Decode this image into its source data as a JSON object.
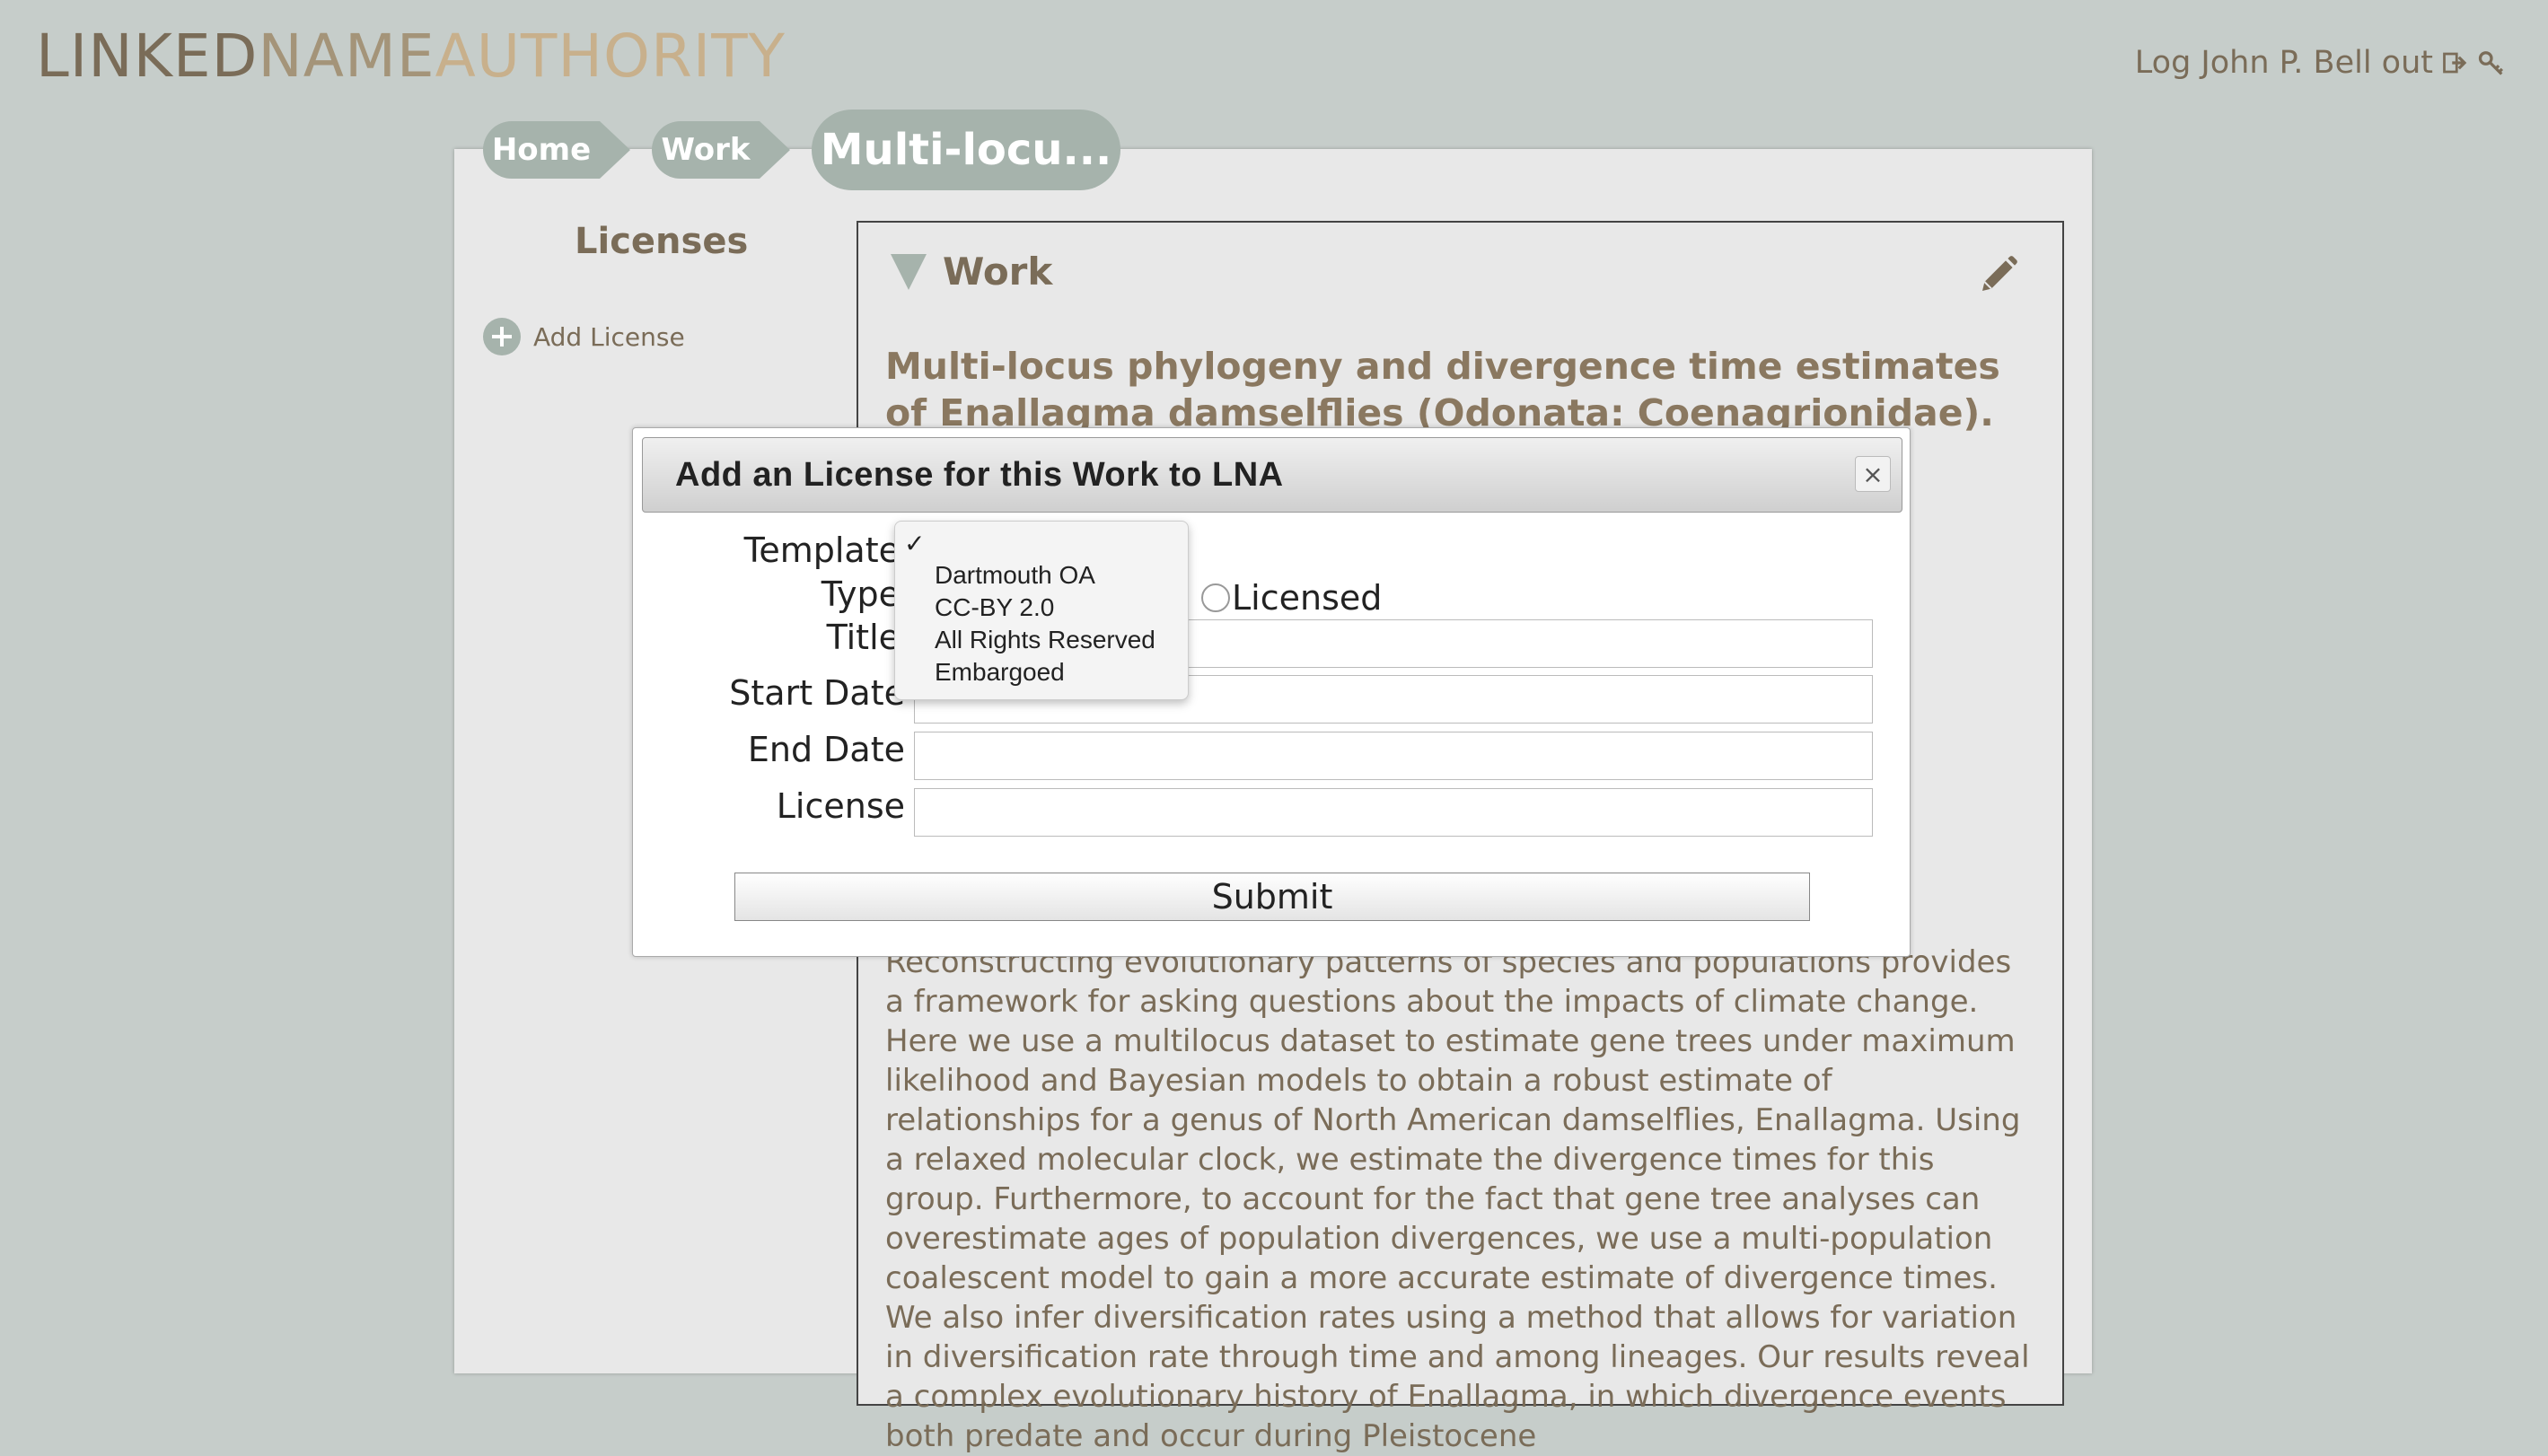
{
  "header": {
    "logo_part1": "LINKED",
    "logo_part2": "NAME",
    "logo_part3": "AUTHORITY",
    "logout_text": "Log John P. Bell out"
  },
  "breadcrumb": {
    "home": "Home",
    "work": "Work",
    "current": "Multi-locu..."
  },
  "sidebar": {
    "title": "Licenses",
    "add_license": "Add License"
  },
  "work": {
    "heading": "Work",
    "title": "Multi-locus phylogeny and divergence time estimates of Enallagma damselflies (Odonata: Coenagrionidae).",
    "abstract": "Reconstructing evolutionary patterns of species and populations provides a framework for asking questions about the impacts of climate change. Here we use a multilocus dataset to estimate gene trees under maximum likelihood and Bayesian models to obtain a robust estimate of relationships for a genus of North American damselflies, Enallagma. Using a relaxed molecular clock, we estimate the divergence times for this group. Furthermore, to account for the fact that gene tree analyses can overestimate ages of population divergences, we use a multi-population coalescent model to gain a more accurate estimate of divergence times. We also infer diversification rates using a method that allows for variation in diversification rate through time and among lineages. Our results reveal a complex evolutionary history of Enallagma, in which divergence events both predate and occur during Pleistocene"
  },
  "modal": {
    "title": "Add an License for this Work to LNA",
    "close": "×",
    "labels": {
      "template": "Template",
      "type": "Type",
      "title": "Title",
      "start_date": "Start Date",
      "end_date": "End Date",
      "license": "License"
    },
    "type_option_licensed": "Licensed",
    "submit": "Submit"
  },
  "dropdown": {
    "check": "✓",
    "options": [
      "Dartmouth OA",
      "CC-BY 2.0",
      "All Rights Reserved",
      "Embargoed"
    ]
  },
  "colors": {
    "background": "#c6cdca",
    "accent": "#a6b3ac",
    "text_brown": "#7a6c58"
  }
}
